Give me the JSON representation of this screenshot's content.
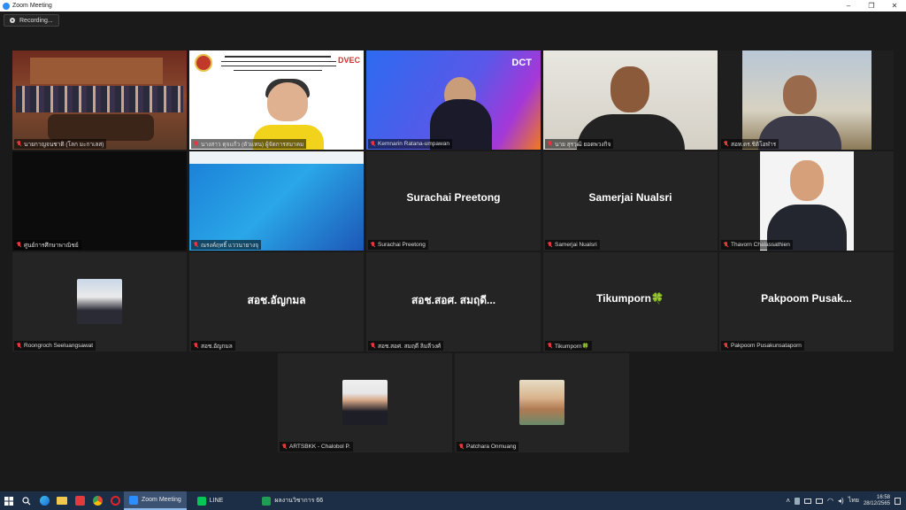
{
  "window": {
    "title": "Zoom Meeting",
    "minimize": "–",
    "maximize": "❐",
    "close": "✕"
  },
  "recording": {
    "label": "Recording..."
  },
  "participants": [
    {
      "id": "p1",
      "name": "นายกาญจนชาติ (โลก มะกาเลส)",
      "show_name_big": false
    },
    {
      "id": "p2",
      "name": "นางสาว ดุจแก้ว (ตัวแทน) ผู้จัดการสมาคม",
      "show_name_big": false
    },
    {
      "id": "p3",
      "name": "Kemnarin Ratana-umpawan",
      "show_name_big": false
    },
    {
      "id": "p4",
      "name": "นาย สุรวุฒิ ยอดพวงกิจ",
      "show_name_big": false
    },
    {
      "id": "p5",
      "name": "สอท.ดร.ชิติโอฬาร",
      "show_name_big": false
    },
    {
      "id": "p6",
      "name": "ศูนย์การศึกษาพาณิชย์",
      "show_name_big": false
    },
    {
      "id": "p7",
      "name": "ณรงค์ฤทธิ์ แววนายางจุ",
      "show_name_big": false
    },
    {
      "id": "p8",
      "name": "Surachai Preetong",
      "show_name_big": true
    },
    {
      "id": "p9",
      "name": "Samerjai Nualsri",
      "show_name_big": true
    },
    {
      "id": "p10",
      "name": "Thavorn Chalassathien",
      "show_name_big": false
    },
    {
      "id": "p11",
      "name": "Roongroch Seeluangsawat",
      "show_name_big": false
    },
    {
      "id": "p12",
      "name": "สอช.อัญกมล",
      "big_name": "สอช.อัญกมล",
      "show_name_big": true
    },
    {
      "id": "p13",
      "name": "สอช.สอศ. สมฤดี ลิมลีวงศ์",
      "big_name": "สอช.สอศ. สมฤดี...",
      "show_name_big": true
    },
    {
      "id": "p14",
      "name": "Tikumporn🍀",
      "big_name": "Tikumporn🍀",
      "show_name_big": true
    },
    {
      "id": "p15",
      "name": "Pakpoom Pusakunsataporn",
      "big_name": "Pakpoom  Pusak...",
      "show_name_big": true
    },
    {
      "id": "p16",
      "name": "ARTSBKK - Chalobol P.",
      "show_name_big": false
    },
    {
      "id": "p17",
      "name": "Patchara Onmuang",
      "show_name_big": false
    }
  ],
  "slides": {
    "dct_logo": "DCT",
    "dvec_logo": "DVEC"
  },
  "taskbar": {
    "apps": [
      {
        "label": "Zoom Meeting",
        "active": true,
        "color": "#2d8cff"
      },
      {
        "label": "LINE",
        "active": false,
        "color": "#06c755"
      },
      {
        "label": "ผลงานวิชาการ 66",
        "active": false,
        "color": "#1f9d55"
      }
    ],
    "language": "ไทย",
    "time": "16:58",
    "date": "28/12/2565"
  }
}
